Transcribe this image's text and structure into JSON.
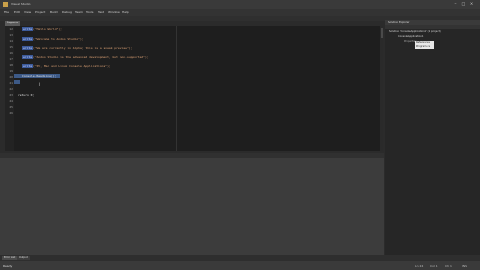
{
  "window": {
    "title": "Visual Studio",
    "minimize_glyph": "–",
    "maximize_glyph": "□",
    "close_glyph": "×"
  },
  "menu": {
    "items": [
      "File",
      "Edit",
      "View",
      "Project",
      "Build",
      "Debug",
      "Team",
      "Tools",
      "Test",
      "Window",
      "Help"
    ]
  },
  "tabs": {
    "active": "Program.cs"
  },
  "editor": {
    "line_numbers": [
      "12",
      "13",
      "14",
      "15",
      "16",
      "17",
      "18",
      "19",
      "20",
      "21",
      "22",
      "23",
      "24",
      "25",
      "26"
    ],
    "lines": [
      {
        "kw": "write",
        "rest": "(\"Hello World\");"
      },
      {
        "kw": "write",
        "rest": "(\"Welcome to Andoo Studio\");"
      },
      {
        "kw": "write",
        "rest": "(\"We are currently in Alpha; this is a sneak preview\");"
      },
      {
        "kw": "write",
        "rest": "(\"Andoo Studio is the advanced development, but non-supported\");"
      },
      {
        "kw": "write",
        "rest": "(\"PC, Mac and Linux Console Applications\");"
      }
    ],
    "selected_line": "Console.ReadLine();",
    "closing_line": "return 0;"
  },
  "solution_explorer": {
    "header": "Solution Explorer",
    "items": [
      "Solution 'ConsoleApplication1' (1 project)",
      "ConsoleApplication1",
      "Properties",
      "References",
      "Program.cs"
    ]
  },
  "bottom_tabs": [
    "Error List",
    "Output"
  ],
  "status": {
    "left": "Ready",
    "ln": "Ln 24",
    "col": "Col 1",
    "ch": "Ch 1",
    "mode": "INS"
  }
}
